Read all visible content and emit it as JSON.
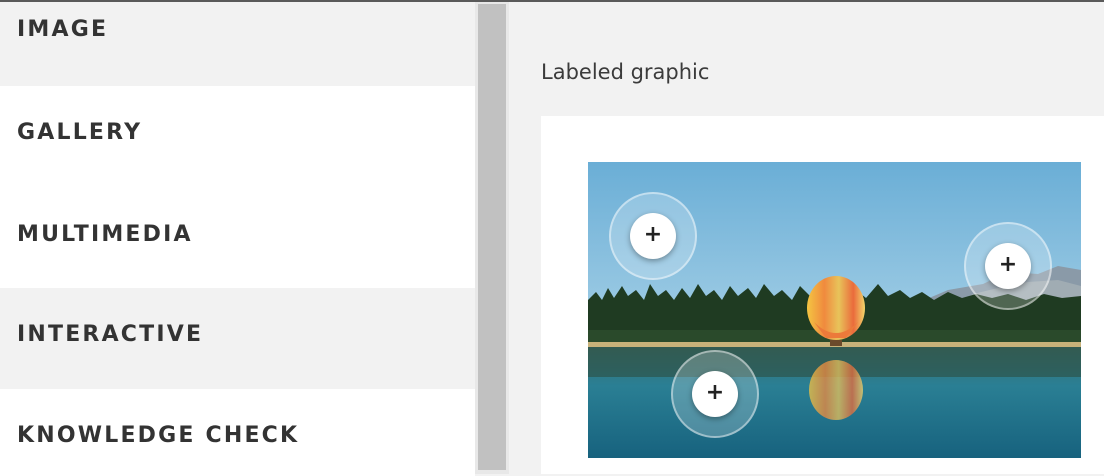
{
  "sidebar": {
    "items": [
      {
        "label": "IMAGE"
      },
      {
        "label": "GALLERY"
      },
      {
        "label": "MULTIMEDIA"
      },
      {
        "label": "INTERACTIVE"
      },
      {
        "label": "KNOWLEDGE CHECK"
      }
    ]
  },
  "content": {
    "block_label": "Labeled graphic",
    "hotspots": [
      {
        "icon": "plus-icon",
        "glyph": "+"
      },
      {
        "icon": "plus-icon",
        "glyph": "+"
      },
      {
        "icon": "plus-icon",
        "glyph": "+"
      }
    ]
  },
  "colors": {
    "sidebar_active": "#ffffff",
    "sidebar_inactive": "#f2f2f2",
    "scrollbar_thumb": "#c1c1c1",
    "text_dark": "#333333"
  }
}
